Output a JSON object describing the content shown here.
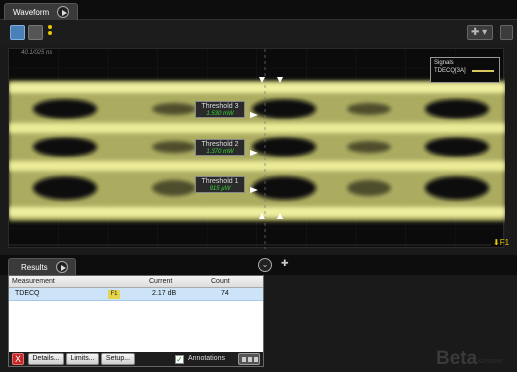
{
  "waveform_tab": {
    "label": "Waveform"
  },
  "timescale": "40.1/025 ns",
  "thresholds": [
    {
      "label": "Threshold 3",
      "value": "1.530 mW"
    },
    {
      "label": "Threshold 2",
      "value": "1.370 mW"
    },
    {
      "label": "Threshold 1",
      "value": "915 µW"
    }
  ],
  "legend": {
    "title": "Signals",
    "signal": "TDECQ[3A]",
    "color": "#d8c860"
  },
  "marker": "F1",
  "results_tab": {
    "label": "Results"
  },
  "results_table": {
    "headers": [
      "Measurement",
      "Current",
      "Count"
    ],
    "rows": [
      {
        "measurement": "TDECQ",
        "source": "F1",
        "current": "2.17 dB",
        "count": "74"
      }
    ]
  },
  "buttons": {
    "delete": "X",
    "details": "Details...",
    "limits": "Limits...",
    "setup": "Setup..."
  },
  "annotations": {
    "label": "Annotations",
    "checked": true
  },
  "watermark": {
    "text": "Beta",
    "sub": "KEYSIGHT"
  },
  "colors": {
    "eye": "#e6e68a",
    "selected_row": "#cde3f7",
    "accent": "#e8c800"
  }
}
